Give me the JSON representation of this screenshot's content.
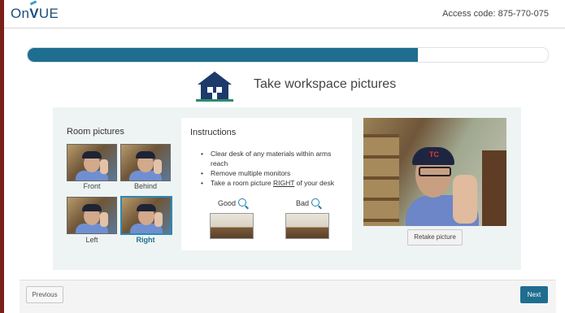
{
  "header": {
    "logo_text_prefix": "On",
    "logo_text_v": "V",
    "logo_text_suffix": "UE",
    "access_code_label": "Access code: 875-770-075"
  },
  "progress": {
    "value_percent": 75
  },
  "page": {
    "title": "Take workspace pictures",
    "icon": "house-icon"
  },
  "room_pictures": {
    "label": "Room pictures",
    "items": [
      {
        "caption": "Front",
        "selected": false
      },
      {
        "caption": "Behind",
        "selected": false
      },
      {
        "caption": "Left",
        "selected": false
      },
      {
        "caption": "Right",
        "selected": true
      }
    ]
  },
  "instructions": {
    "title": "Instructions",
    "items": [
      "Clear desk of any materials within arms reach",
      "Remove multiple monitors"
    ],
    "last_item_prefix": "Take a room picture ",
    "last_item_emphasis": "RIGHT",
    "last_item_suffix": " of your desk",
    "good_label": "Good",
    "bad_label": "Bad"
  },
  "buttons": {
    "retake": "Retake picture",
    "previous": "Previous",
    "next": "Next"
  },
  "colors": {
    "accent": "#1f6e8f",
    "panel_bg": "#eef4f3",
    "selected_border": "#2a8ab5"
  }
}
